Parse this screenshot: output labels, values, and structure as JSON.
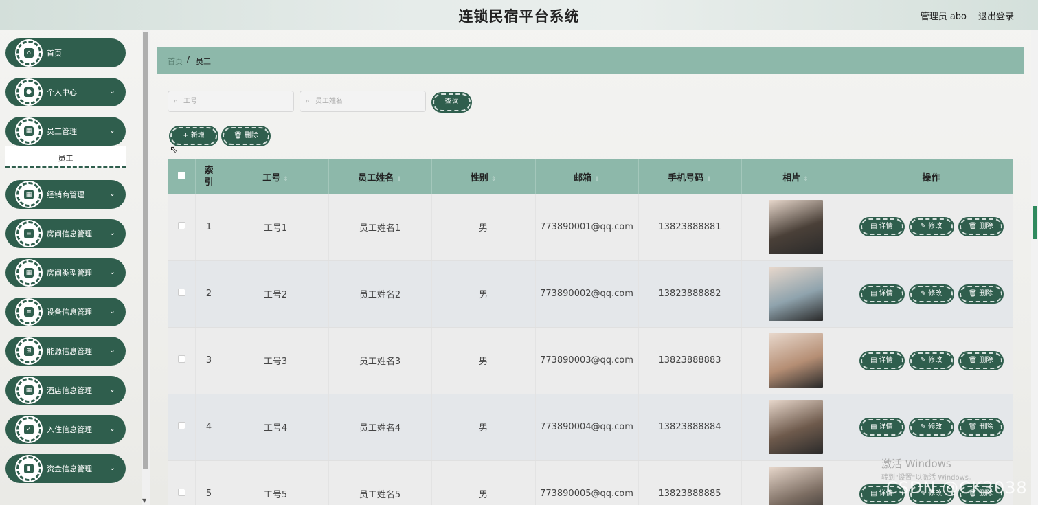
{
  "header": {
    "title": "连锁民宿平台系统",
    "user": "管理员 abo",
    "logout": "退出登录"
  },
  "sidebar": {
    "items": [
      {
        "label": "首页",
        "icon": "home-icon",
        "glyph": "⌂",
        "chevron": ""
      },
      {
        "label": "个人中心",
        "icon": "user-icon",
        "glyph": "●",
        "chevron": "⌄"
      },
      {
        "label": "员工管理",
        "icon": "grid-icon",
        "glyph": "▦",
        "chevron": "⌄"
      },
      {
        "label": "经销商管理",
        "icon": "grid-icon",
        "glyph": "▦",
        "chevron": "⌄"
      },
      {
        "label": "房间信息管理",
        "icon": "list-icon",
        "glyph": "≡",
        "chevron": "⌄"
      },
      {
        "label": "房间类型管理",
        "icon": "grid-icon",
        "glyph": "▦",
        "chevron": "⌄"
      },
      {
        "label": "设备信息管理",
        "icon": "list-icon",
        "glyph": "≡",
        "chevron": "⌄"
      },
      {
        "label": "能源信息管理",
        "icon": "apps-icon",
        "glyph": "⊞",
        "chevron": "⌄"
      },
      {
        "label": "酒店信息管理",
        "icon": "grid-icon",
        "glyph": "▦",
        "chevron": "⌄"
      },
      {
        "label": "入住信息管理",
        "icon": "check-icon",
        "glyph": "✓",
        "chevron": "⌄"
      },
      {
        "label": "资金信息管理",
        "icon": "bar-chart-icon",
        "glyph": "▮",
        "chevron": "⌄"
      }
    ],
    "submenu_active": "员工"
  },
  "breadcrumb": {
    "home": "首页",
    "sep": "/",
    "current": "员工"
  },
  "search": {
    "id_placeholder": "工号",
    "name_placeholder": "员工姓名",
    "query_label": "查询"
  },
  "actions": {
    "add_label": "+ 新增",
    "delete_label": "🗑 删除"
  },
  "table": {
    "headers": [
      "索引",
      "工号",
      "员工姓名",
      "性别",
      "邮箱",
      "手机号码",
      "相片",
      "操作"
    ],
    "rows": [
      {
        "index": "1",
        "id": "工号1",
        "name": "员工姓名1",
        "gender": "男",
        "email": "773890001@qq.com",
        "phone": "13823888881",
        "photo_color": "#4a4038"
      },
      {
        "index": "2",
        "id": "工号2",
        "name": "员工姓名2",
        "gender": "男",
        "email": "773890002@qq.com",
        "phone": "13823888882",
        "photo_color": "#8fa3ad"
      },
      {
        "index": "3",
        "id": "工号3",
        "name": "员工姓名3",
        "gender": "男",
        "email": "773890003@qq.com",
        "phone": "13823888883",
        "photo_color": "#b58e74"
      },
      {
        "index": "4",
        "id": "工号4",
        "name": "员工姓名4",
        "gender": "男",
        "email": "773890004@qq.com",
        "phone": "13823888884",
        "photo_color": "#6e5a4c"
      },
      {
        "index": "5",
        "id": "工号5",
        "name": "员工姓名5",
        "gender": "男",
        "email": "773890005@qq.com",
        "phone": "13823888885",
        "photo_color": "#7c6d62"
      }
    ],
    "op_labels": {
      "detail": "▤ 详情",
      "edit": "✎ 修改",
      "delete": "🗑 删除"
    }
  },
  "watermark": {
    "activate": "激活 Windows",
    "activate_sub": "转到\"设置\"以激活 Windows。",
    "csdn": "CSDN @CK3038"
  },
  "colors": {
    "primary": "#2f5e4d",
    "header_bar": "#8db8aa"
  }
}
